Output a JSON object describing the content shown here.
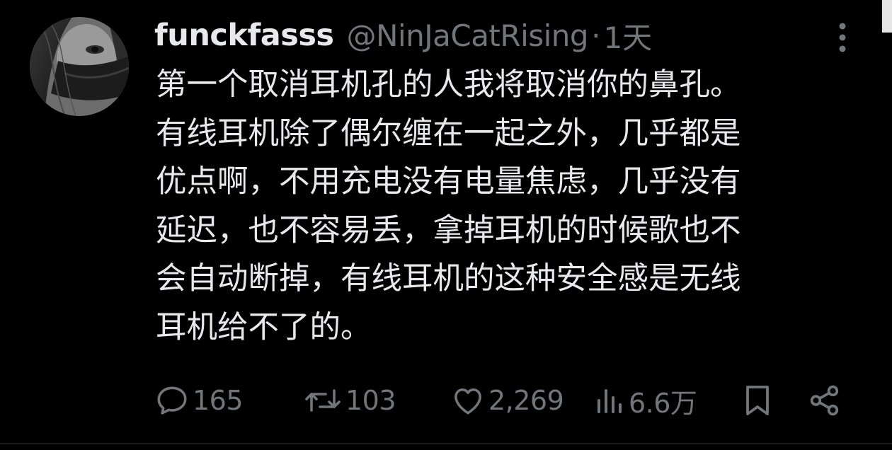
{
  "tweet": {
    "display_name": "funckfasss",
    "handle": "@NinJaCatRising",
    "separator": "·",
    "time": "1天",
    "lines": [
      "第一个取消耳机孔的人我将取消你的鼻孔。",
      "有线耳机除了偶尔缠在一起之外，几乎都是",
      "优点啊，不用充电没有电量焦虑，几乎没有",
      "延迟，也不容易丢，拿掉耳机的时候歌也不",
      "会自动断掉，有线耳机的这种安全感是无线",
      "耳机给不了的。"
    ]
  },
  "actions": {
    "reply": {
      "icon": "reply-icon",
      "count": "165"
    },
    "repost": {
      "icon": "repost-icon",
      "count": "103"
    },
    "like": {
      "icon": "heart-icon",
      "count": "2,269"
    },
    "views": {
      "icon": "views-icon",
      "count": "6.6万"
    },
    "bookmark": {
      "icon": "bookmark-icon"
    },
    "share": {
      "icon": "share-icon"
    }
  },
  "colors": {
    "background": "#000000",
    "text_primary": "#e7e9ea",
    "text_secondary": "#71767b"
  }
}
